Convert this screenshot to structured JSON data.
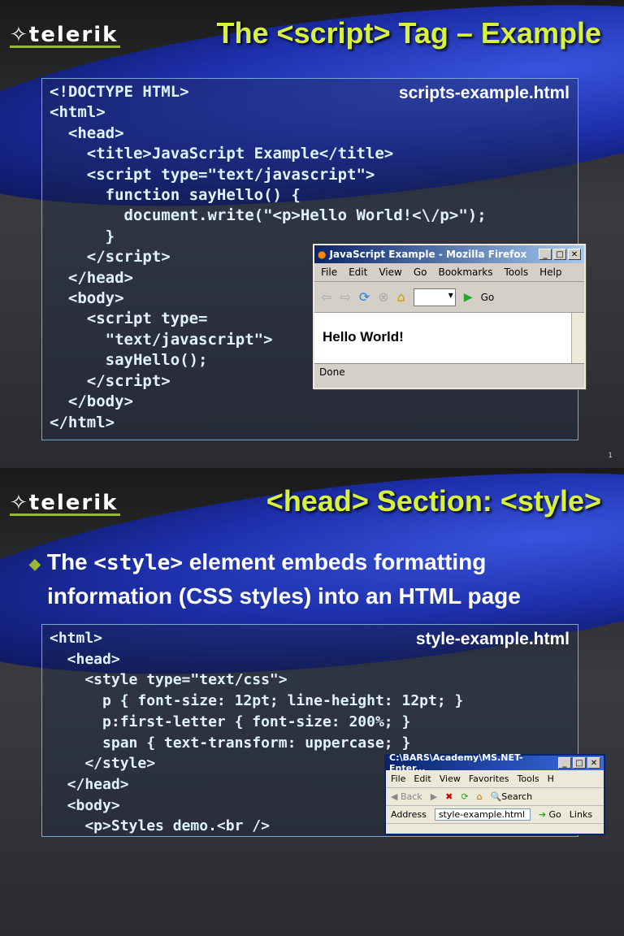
{
  "slide1": {
    "logo": "telerik",
    "title": "The <script> Tag – Example",
    "filename": "scripts-example.html",
    "code": [
      "<!DOCTYPE HTML>",
      "<html>",
      "  <head>",
      "    <title>JavaScript Example</title>",
      "    <script type=\"text/javascript\">",
      "      function sayHello() {",
      "        document.write(\"<p>Hello World!<\\/p>\");",
      "      }",
      "    </script>",
      "  </head>",
      "  <body>",
      "    <script type=",
      "      \"text/javascript\">",
      "      sayHello();",
      "    </script>",
      "  </body>",
      "</html>"
    ],
    "slide_number": "1",
    "browser": {
      "title": "JavaScript Example - Mozilla Firefox",
      "menu": [
        "File",
        "Edit",
        "View",
        "Go",
        "Bookmarks",
        "Tools",
        "Help"
      ],
      "go_label": "Go",
      "content": "Hello World!",
      "status": "Done"
    }
  },
  "slide2": {
    "logo": "telerik",
    "title": "<head> Section: <style>",
    "bullet": {
      "pre": "The ",
      "code": "<style>",
      "post": " element embeds formatting",
      "line2": "information (CSS styles) into an HTML page"
    },
    "filename": "style-example.html",
    "code": [
      "<html>",
      "  <head>",
      "    <style type=\"text/css\">",
      "      p { font-size: 12pt; line-height: 12pt; }",
      "      p:first-letter { font-size: 200%; }",
      "      span { text-transform: uppercase; }",
      "    </style>",
      "  </head>",
      "  <body>",
      "    <p>Styles demo.<br />"
    ],
    "browser": {
      "title": "C:\\BARS\\Academy\\MS.NET-Enter...",
      "menu": [
        "File",
        "Edit",
        "View",
        "Favorites",
        "Tools",
        "H"
      ],
      "back_label": "Back",
      "search_label": "Search",
      "address_label": "Address",
      "address_value": "style-example.html",
      "go_label": "Go",
      "links_label": "Links"
    }
  }
}
